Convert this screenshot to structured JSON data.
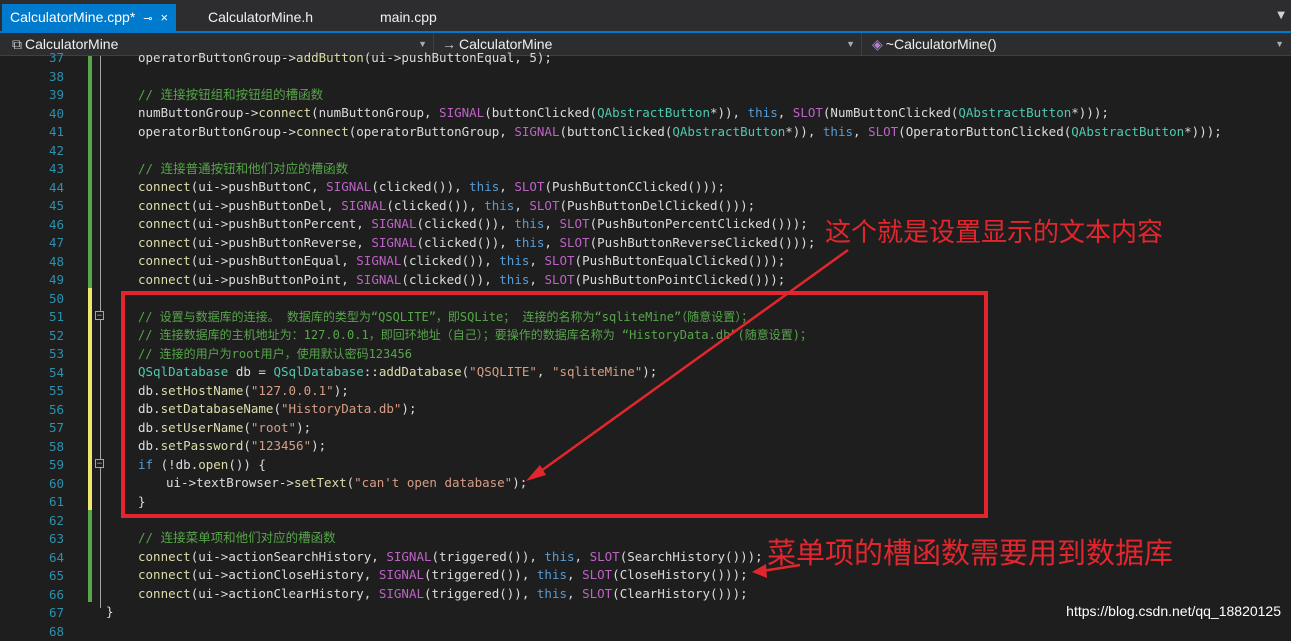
{
  "tabs": [
    {
      "label": "CalculatorMine.cpp*",
      "pin": "⊸",
      "close": "×"
    },
    {
      "label": "CalculatorMine.h"
    },
    {
      "label": "main.cpp"
    }
  ],
  "nav": {
    "project": "CalculatorMine",
    "class": "CalculatorMine",
    "member": "~CalculatorMine()"
  },
  "line_numbers": [
    "37",
    "38",
    "39",
    "40",
    "41",
    "42",
    "43",
    "44",
    "45",
    "46",
    "47",
    "48",
    "49",
    "50",
    "51",
    "52",
    "53",
    "54",
    "55",
    "56",
    "57",
    "58",
    "59",
    "60",
    "61",
    "62",
    "63",
    "64",
    "65",
    "66",
    "67",
    "68"
  ],
  "code": {
    "l37": {
      "a": "operatorButtonGroup->",
      "b": "addButton",
      "c": "(ui->pushButtonEqual, 5);"
    },
    "l39": "// 连接按钮组和按钮组的槽函数",
    "l40": {
      "a": "numButtonGroup->",
      "b": "connect",
      "c": "(numButtonGroup, ",
      "d": "SIGNAL",
      "e": "(buttonClicked(",
      "f": "QAbstractButton",
      "g": "*)), ",
      "h": "this",
      "i": ", ",
      "j": "SLOT",
      "k": "(NumButtonClicked(",
      "l": "QAbstractButton",
      "m": "*)));"
    },
    "l41": {
      "a": "operatorButtonGroup->",
      "b": "connect",
      "c": "(operatorButtonGroup, ",
      "d": "SIGNAL",
      "e": "(buttonClicked(",
      "f": "QAbstractButton",
      "g": "*)), ",
      "h": "this",
      "i": ", ",
      "j": "SLOT",
      "k": "(OperatorButtonClicked(",
      "l": "QAbstractButton",
      "m": "*)));"
    },
    "l43": "// 连接普通按钮和他们对应的槽函数",
    "l44": {
      "a": "connect",
      "b": "(ui->pushButtonC, ",
      "c": "SIGNAL",
      "d": "(clicked()), ",
      "e": "this",
      "f": ", ",
      "g": "SLOT",
      "h": "(PushButtonCClicked()));"
    },
    "l45": {
      "a": "connect",
      "b": "(ui->pushButtonDel, ",
      "c": "SIGNAL",
      "d": "(clicked()), ",
      "e": "this",
      "f": ", ",
      "g": "SLOT",
      "h": "(PushButtonDelClicked()));"
    },
    "l46": {
      "a": "connect",
      "b": "(ui->pushButtonPercent, ",
      "c": "SIGNAL",
      "d": "(clicked()), ",
      "e": "this",
      "f": ", ",
      "g": "SLOT",
      "h": "(PushButonPercentClicked()));"
    },
    "l47": {
      "a": "connect",
      "b": "(ui->pushButtonReverse, ",
      "c": "SIGNAL",
      "d": "(clicked()), ",
      "e": "this",
      "f": ", ",
      "g": "SLOT",
      "h": "(PushButtonReverseClicked()));"
    },
    "l48": {
      "a": "connect",
      "b": "(ui->pushButtonEqual, ",
      "c": "SIGNAL",
      "d": "(clicked()), ",
      "e": "this",
      "f": ", ",
      "g": "SLOT",
      "h": "(PushButtonEqualClicked()));"
    },
    "l49": {
      "a": "connect",
      "b": "(ui->pushButtonPoint, ",
      "c": "SIGNAL",
      "d": "(clicked()), ",
      "e": "this",
      "f": ", ",
      "g": "SLOT",
      "h": "(PushButtonPointClicked()));"
    },
    "l51": "// 设置与数据库的连接。 数据库的类型为“QSQLITE”，即SQLite； 连接的名称为“sqliteMine”（随意设置）；",
    "l52": "// 连接数据库的主机地址为：127.0.0.1，即回环地址（自己）；要操作的数据库名称为 “HistoryData.db”(随意设置)；",
    "l53": "// 连接的用户为root用户，使用默认密码123456",
    "l54": {
      "a": "QSqlDatabase",
      "b": " db = ",
      "c": "QSqlDatabase",
      "d": "::",
      "e": "addDatabase",
      "f": "(",
      "g": "\"QSQLITE\"",
      "h": ", ",
      "i": "\"sqliteMine\"",
      "j": ");"
    },
    "l55": {
      "a": "db.",
      "b": "setHostName",
      "c": "(",
      "d": "\"127.0.0.1\"",
      "e": ");"
    },
    "l56": {
      "a": "db.",
      "b": "setDatabaseName",
      "c": "(",
      "d": "\"HistoryData.db\"",
      "e": ");"
    },
    "l57": {
      "a": "db.",
      "b": "setUserName",
      "c": "(",
      "d": "\"root\"",
      "e": ");"
    },
    "l58": {
      "a": "db.",
      "b": "setPassword",
      "c": "(",
      "d": "\"123456\"",
      "e": ");"
    },
    "l59": {
      "a": "if",
      "b": " (!db.",
      "c": "open",
      "d": "()) {"
    },
    "l60": {
      "a": "ui->textBrowser->",
      "b": "setText",
      "c": "(",
      "d": "\"can't open database\"",
      "e": ");"
    },
    "l61": "}",
    "l63": "// 连接菜单项和他们对应的槽函数",
    "l64": {
      "a": "connect",
      "b": "(ui->actionSearchHistory, ",
      "c": "SIGNAL",
      "d": "(triggered()), ",
      "e": "this",
      "f": ", ",
      "g": "SLOT",
      "h": "(SearchHistory()));"
    },
    "l65": {
      "a": "connect",
      "b": "(ui->actionCloseHistory, ",
      "c": "SIGNAL",
      "d": "(triggered()), ",
      "e": "this",
      "f": ", ",
      "g": "SLOT",
      "h": "(CloseHistory()));"
    },
    "l66": {
      "a": "connect",
      "b": "(ui->actionClearHistory, ",
      "c": "SIGNAL",
      "d": "(triggered()), ",
      "e": "this",
      "f": ", ",
      "g": "SLOT",
      "h": "(ClearHistory()));"
    },
    "l67": "}"
  },
  "annotations": {
    "top": "这个就是设置显示的文本内容",
    "bottom": "菜单项的槽函数需要用到数据库"
  },
  "watermark": "https://blog.csdn.net/qq_18820125",
  "colors": {
    "accent": "#007acc",
    "annotation": "#e3262d",
    "comment": "#57a64a",
    "keyword": "#569cd6",
    "macro": "#bd63c5",
    "string": "#d69d85",
    "type": "#4ec9b0",
    "function": "#dcdcaa"
  }
}
